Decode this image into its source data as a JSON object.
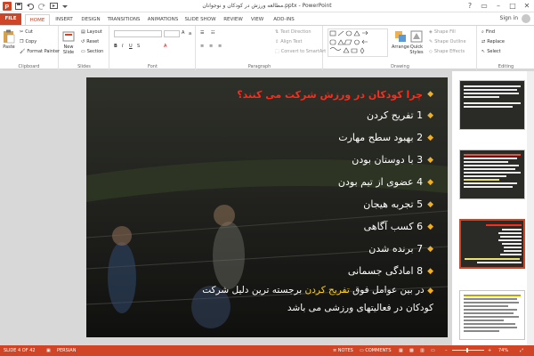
{
  "window": {
    "title": "مطالعه ورزش در کودکان و نوجوانان.pptx - PowerPoint",
    "controls": {
      "help": "?",
      "ribbon_display": "▭",
      "minimize": "–",
      "maximize": "□",
      "close": "✕"
    }
  },
  "quick_access": [
    "save-icon",
    "undo-icon",
    "redo-icon",
    "start-slideshow-icon",
    "customize-icon"
  ],
  "tabs": [
    {
      "label": "FILE"
    },
    {
      "label": "HOME",
      "active": true
    },
    {
      "label": "INSERT"
    },
    {
      "label": "DESIGN"
    },
    {
      "label": "TRANSITIONS"
    },
    {
      "label": "ANIMATIONS"
    },
    {
      "label": "SLIDE SHOW"
    },
    {
      "label": "REVIEW"
    },
    {
      "label": "VIEW"
    },
    {
      "label": "ADD-INS"
    }
  ],
  "account": {
    "sign_in": "Sign in"
  },
  "ribbon": {
    "clipboard": {
      "label": "Clipboard",
      "paste": "Paste",
      "cut": "Cut",
      "copy": "Copy",
      "format_painter": "Format Painter"
    },
    "slides": {
      "label": "Slides",
      "new_slide": "New",
      "new_slide_2": "Slide",
      "layout": "Layout",
      "reset": "Reset",
      "section": "Section"
    },
    "font": {
      "label": "Font"
    },
    "paragraph": {
      "label": "Paragraph",
      "text_direction": "Text Direction",
      "align_text": "Align Text",
      "convert_smartart": "Convert to SmartArt"
    },
    "drawing": {
      "label": "Drawing",
      "arrange": "Arrange",
      "quick_styles": "Quick",
      "quick_styles_2": "Styles",
      "shape_fill": "Shape Fill",
      "shape_outline": "Shape Outline",
      "shape_effects": "Shape Effects"
    },
    "editing": {
      "label": "Editing",
      "find": "Find",
      "replace": "Replace",
      "select": "Select"
    }
  },
  "thumbnails": [
    {
      "number": "2"
    },
    {
      "number": "3"
    },
    {
      "number": "4",
      "selected": true
    },
    {
      "number": "5"
    }
  ],
  "slide": {
    "heading": "چرا کودکان در ورزش شرکت می کنند؟",
    "items": [
      "1 تفریح کردن",
      "2 بهبود سطح مهارت",
      "3 با دوستان بودن",
      "4 عضوی از تیم بودن",
      "5 تجربه هیجان",
      "6 کسب آگاهی",
      "7 برنده شدن",
      "8 امادگی جسمانی"
    ],
    "last_before": "در بین عوامل فوق",
    "last_highlight": "تفریح کردن",
    "last_after": "برجسته ترین دلیل شرکت",
    "last_line2": "کودکان در فعالیتهای ورزشی می باشد"
  },
  "status": {
    "slide_of": "SLIDE 4 OF 42",
    "language": "PERSIAN",
    "notes": "NOTES",
    "comments": "COMMENTS",
    "zoom": "74%"
  },
  "colors": {
    "accent": "#d04525",
    "slide_heading": "#ff2a1a",
    "highlight": "#ffd21c",
    "bullet": "#f2b01e"
  }
}
